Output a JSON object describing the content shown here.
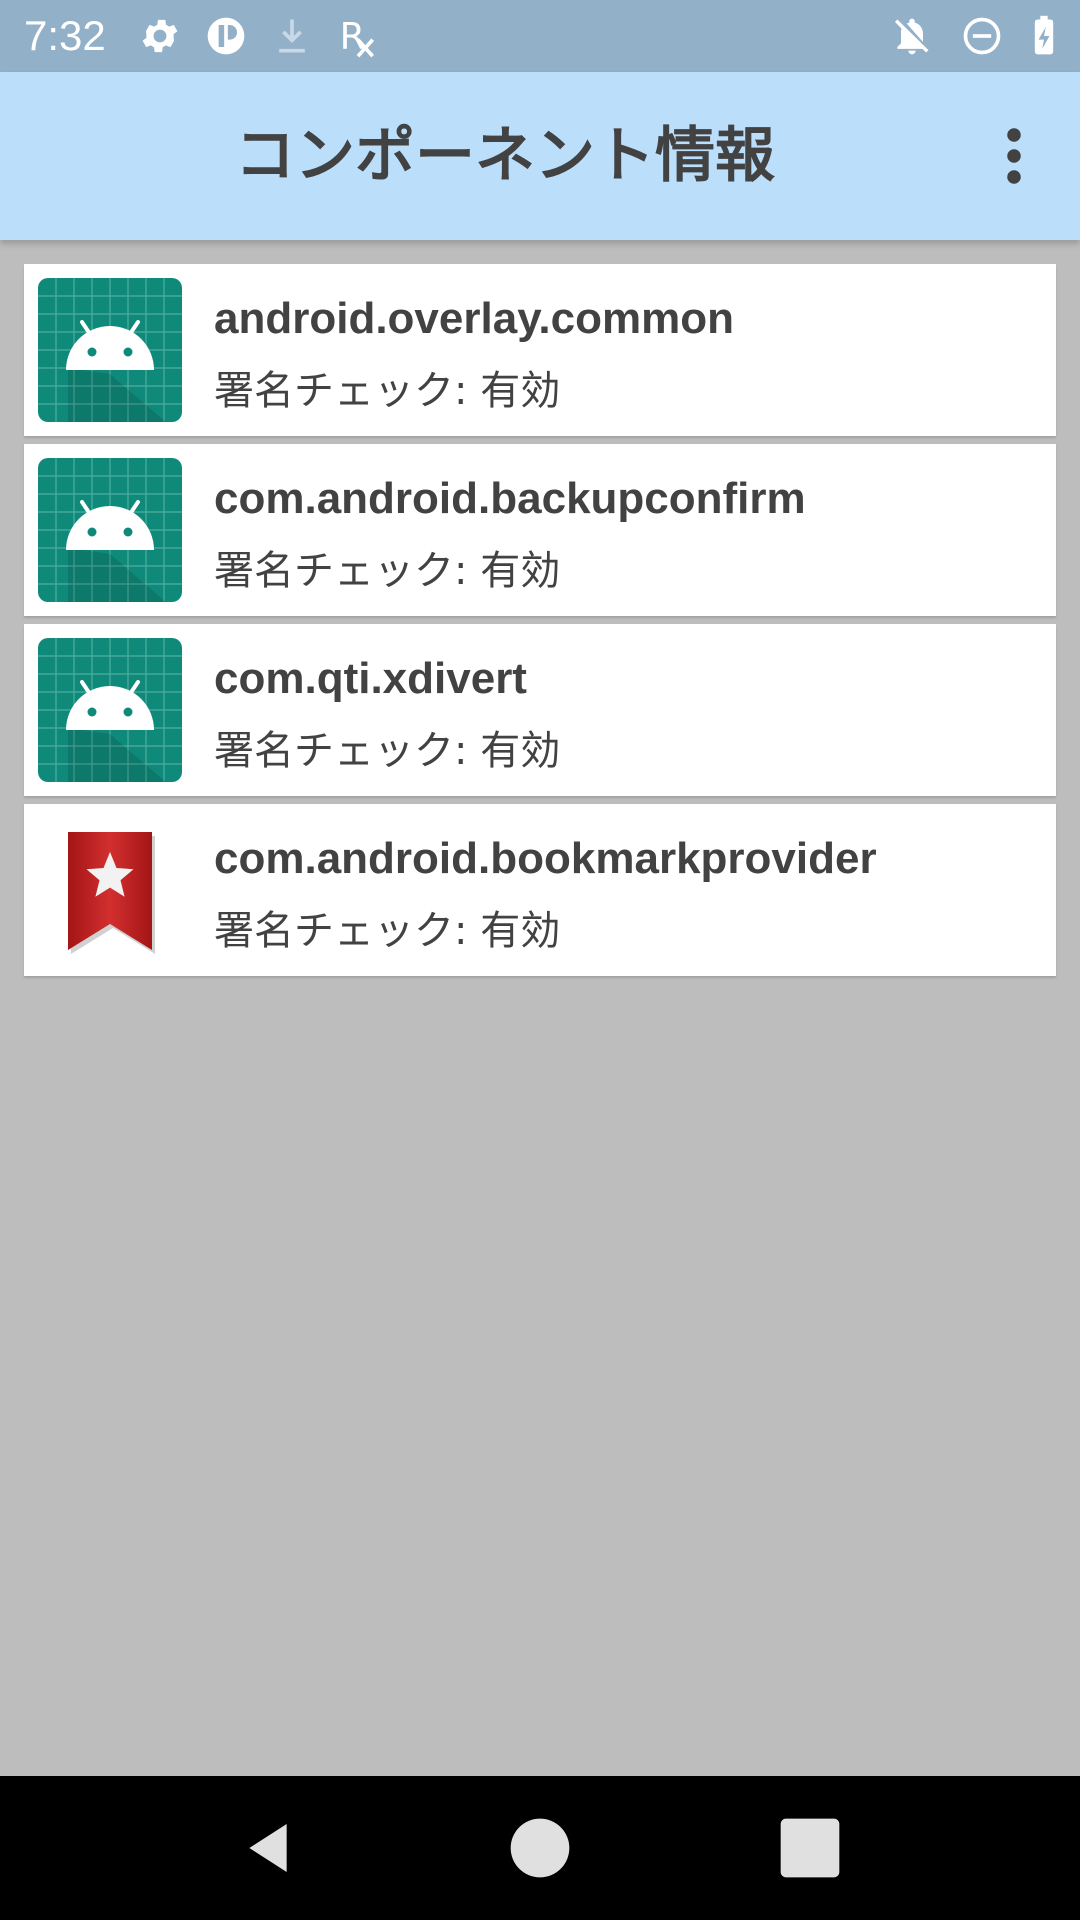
{
  "status_bar": {
    "time": "7:32",
    "icons_left": [
      "settings-icon",
      "app-badge-icon",
      "download-icon",
      "rx-icon"
    ],
    "icons_right": [
      "notifications-off-icon",
      "do-not-disturb-icon",
      "battery-charging-icon"
    ]
  },
  "app_bar": {
    "title": "コンポーネント情報",
    "menu_icon": "more-vert-icon"
  },
  "components": [
    {
      "name": "android.overlay.common",
      "status": "署名チェック: 有効",
      "icon": "android-icon"
    },
    {
      "name": "com.android.backupconfirm",
      "status": "署名チェック: 有効",
      "icon": "android-icon"
    },
    {
      "name": "com.qti.xdivert",
      "status": "署名チェック: 有効",
      "icon": "android-icon"
    },
    {
      "name": "com.android.bookmarkprovider",
      "status": "署名チェック: 有効",
      "icon": "bookmark-icon"
    }
  ],
  "nav_bar": {
    "buttons": [
      "back-icon",
      "home-icon",
      "recents-icon"
    ]
  },
  "colors": {
    "status_bar": "#93b0c9",
    "app_bar": "#bbdefb",
    "background": "#bdbdbd",
    "android_icon_bg": "#0f8a7a",
    "bookmark_red": "#c62828"
  }
}
